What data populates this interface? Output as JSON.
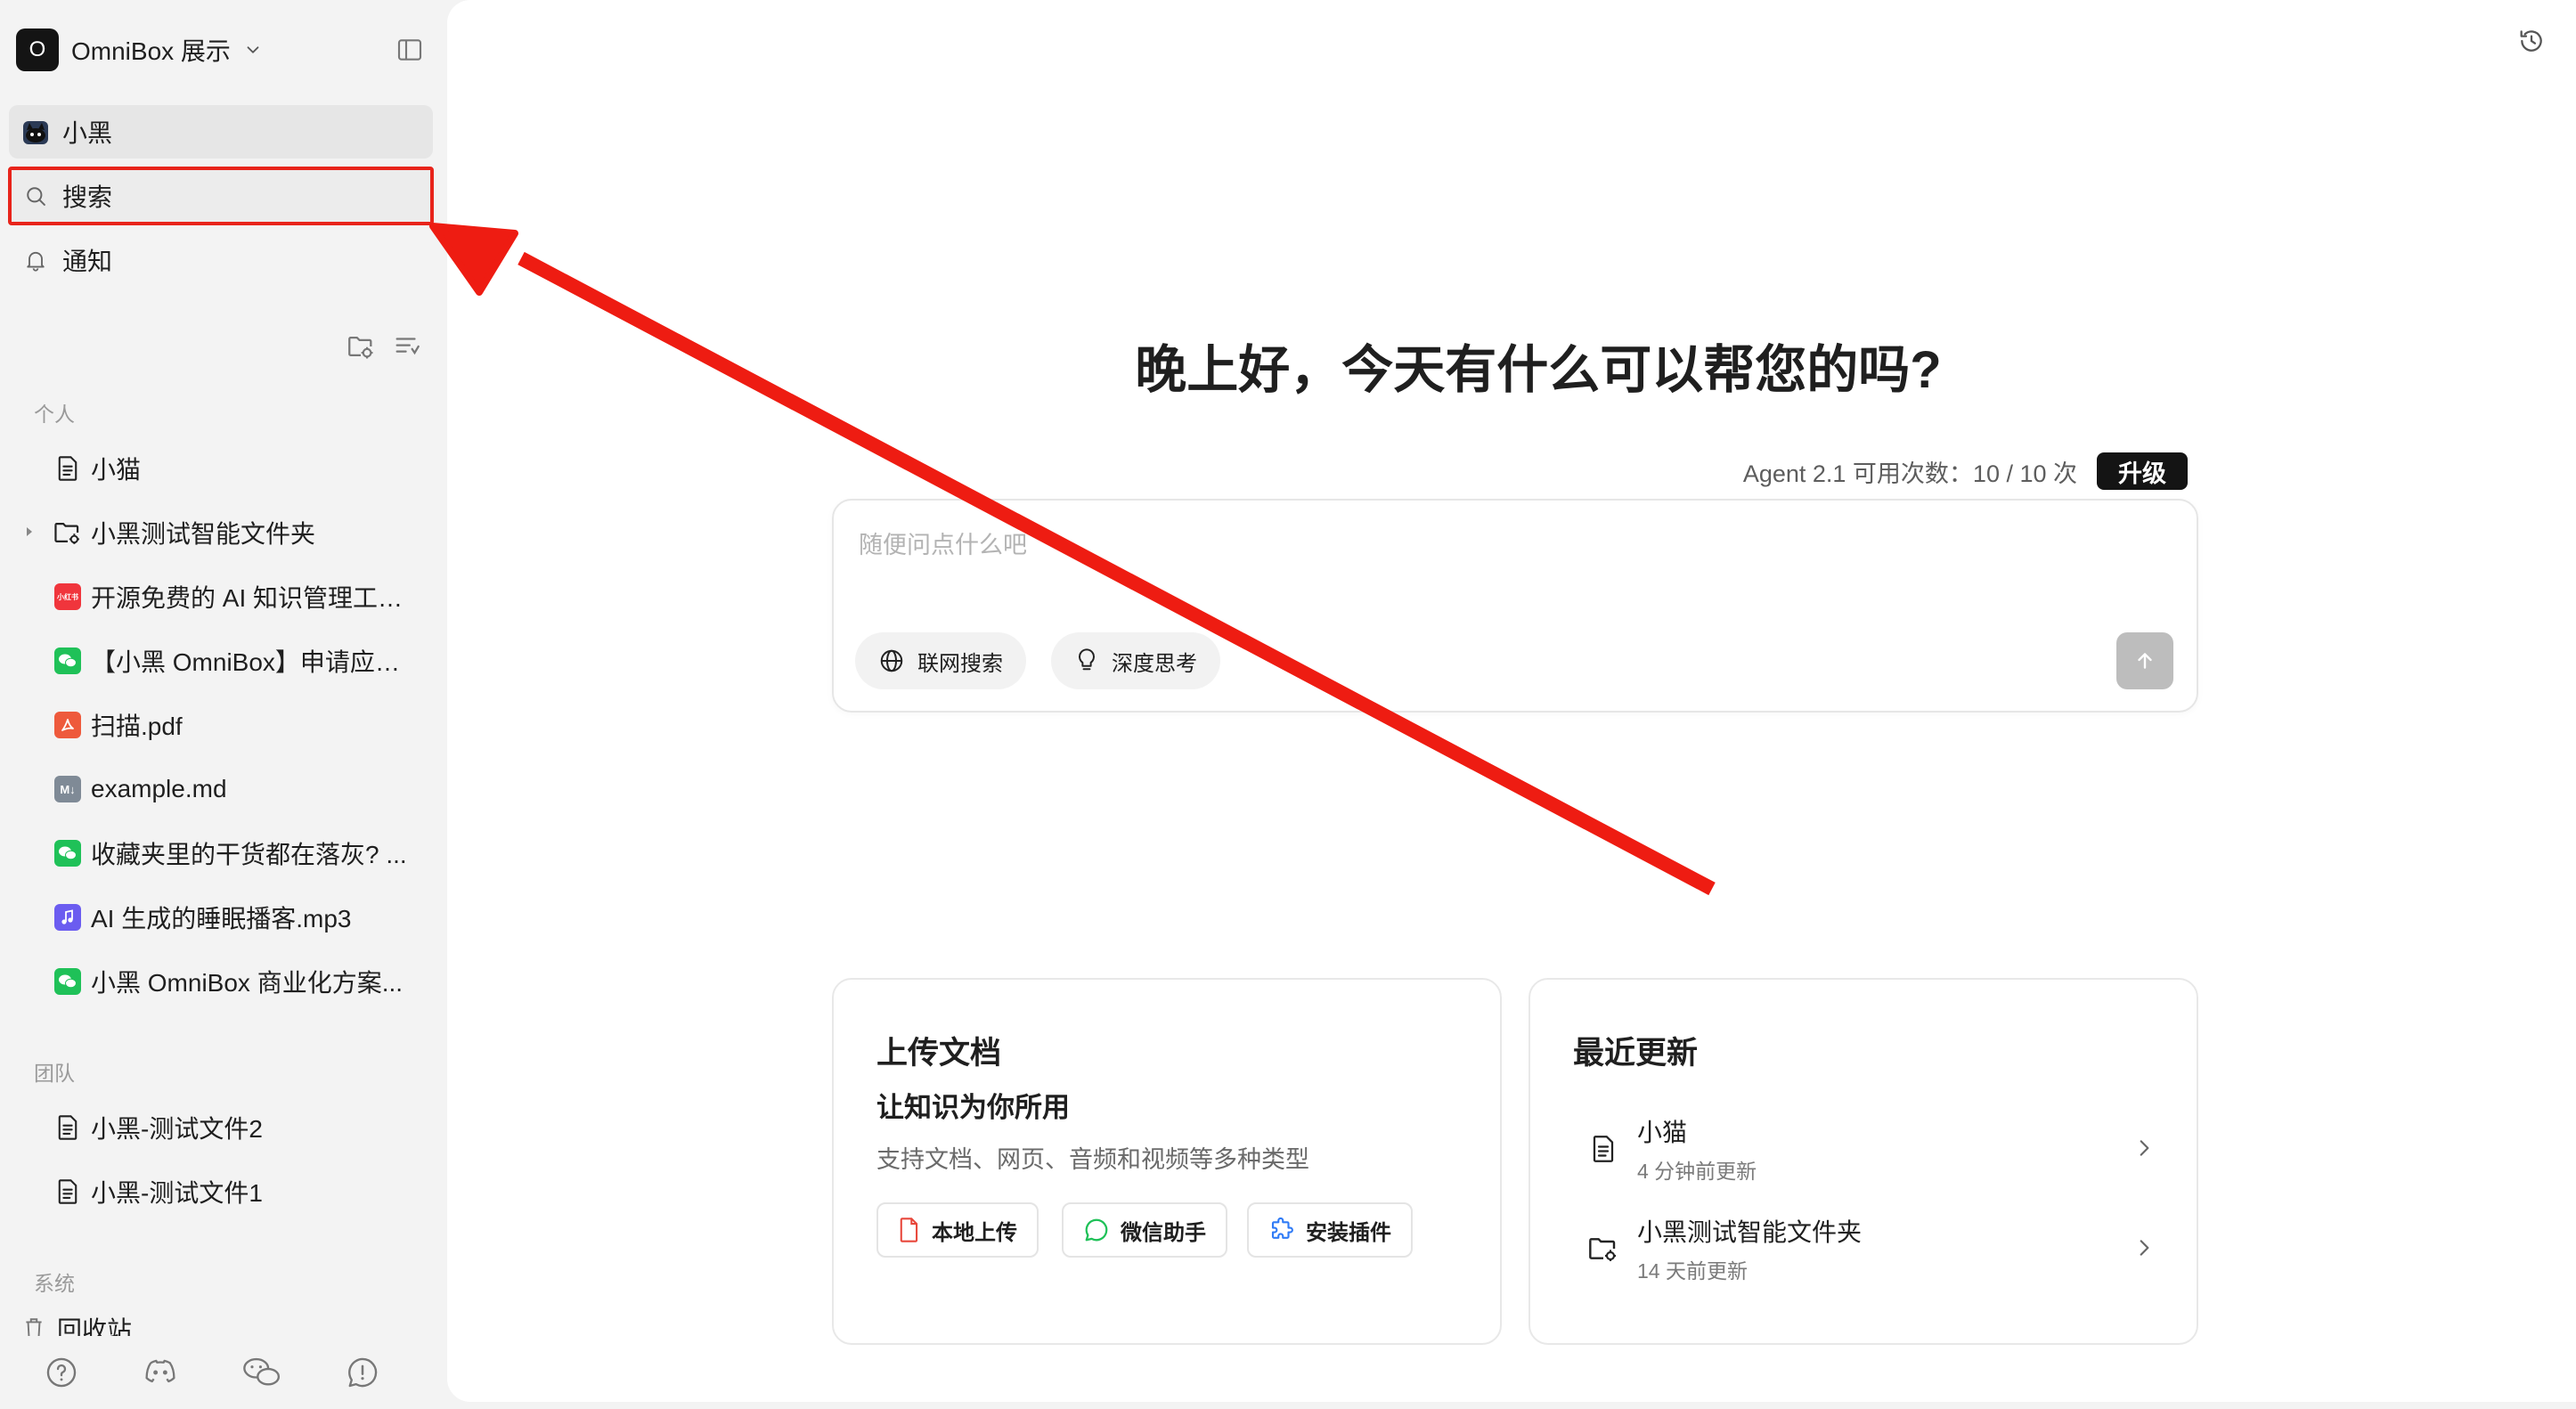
{
  "workspace": {
    "avatar_letter": "O",
    "name": "OmniBox 展示"
  },
  "nav": {
    "agent_label": "小黑",
    "search_label": "搜索",
    "notify_label": "通知"
  },
  "sections": {
    "personal": "个人",
    "team": "团队",
    "system": "系统"
  },
  "personal_items": [
    {
      "name": "小猫",
      "icon": "document-icon"
    },
    {
      "name": "小黑测试智能文件夹",
      "icon": "smart-folder-icon"
    },
    {
      "name": "开源免费的 AI 知识管理工具...",
      "icon": "xiaohongshu-icon",
      "badge_text": "小红书"
    },
    {
      "name": "【小黑 OmniBox】申请应聘...",
      "icon": "wechat-icon"
    },
    {
      "name": "扫描.pdf",
      "icon": "pdf-icon"
    },
    {
      "name": "example.md",
      "icon": "markdown-icon",
      "badge_text": "M↓"
    },
    {
      "name": "收藏夹里的干货都在落灰? ...",
      "icon": "wechat-icon"
    },
    {
      "name": "AI 生成的睡眠播客.mp3",
      "icon": "audio-icon"
    },
    {
      "name": "小黑 OmniBox 商业化方案...",
      "icon": "wechat-icon"
    }
  ],
  "team_items": [
    {
      "name": "小黑-测试文件2",
      "icon": "document-icon"
    },
    {
      "name": "小黑-测试文件1",
      "icon": "document-icon"
    }
  ],
  "system_items": [
    {
      "name": "回收站",
      "icon": "trash-icon"
    }
  ],
  "main": {
    "greeting": "晚上好，今天有什么可以帮您的吗?",
    "quota_text": "Agent 2.1 可用次数：10 / 10 次",
    "upgrade_label": "升级",
    "chat_placeholder": "随便问点什么吧",
    "chip_web": "联网搜索",
    "chip_think": "深度思考"
  },
  "upload_card": {
    "title": "上传文档",
    "subtitle": "让知识为你所用",
    "desc": "支持文档、网页、音频和视频等多种类型",
    "btn_local": "本地上传",
    "btn_wechat": "微信助手",
    "btn_plugin": "安装插件"
  },
  "recent_card": {
    "title": "最近更新",
    "items": [
      {
        "name": "小猫",
        "time": "4 分钟前更新",
        "icon": "document-icon"
      },
      {
        "name": "小黑测试智能文件夹",
        "time": "14 天前更新",
        "icon": "smart-folder-icon"
      }
    ]
  },
  "colors": {
    "accent_dark": "#141414",
    "highlight_red": "#e8241b",
    "wechat_green": "#1fc158",
    "pdf_red": "#ee5a3c",
    "audio_purple": "#6b5cf0"
  }
}
